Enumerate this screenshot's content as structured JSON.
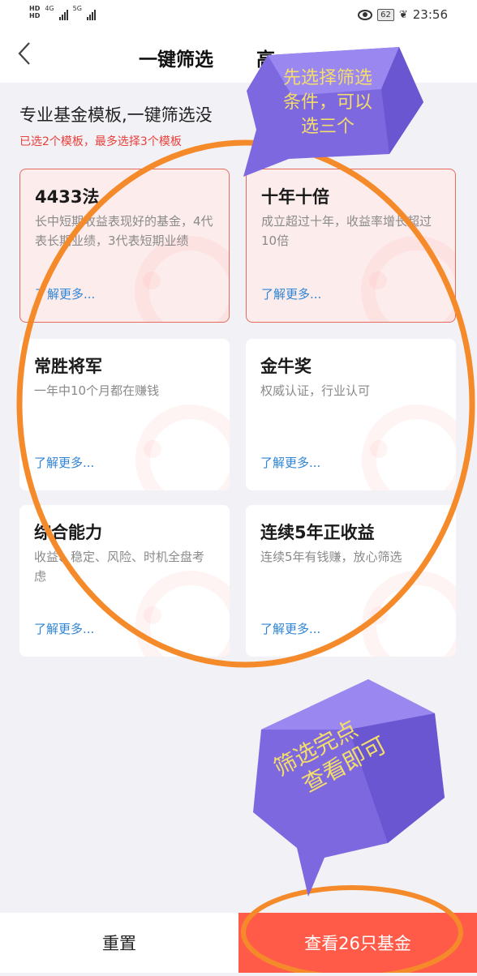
{
  "status_bar": {
    "hd_top": "HD",
    "hd_bottom": "HD",
    "net1": "4G",
    "net2": "5G",
    "battery": "62",
    "time": "23:56"
  },
  "nav": {
    "back_icon": "chevron-left-icon",
    "title": "一键筛选",
    "tab2": "高"
  },
  "headline": "专业基金模板,一键筛选没",
  "selected_note": "已选2个模板，最多选择3个模板",
  "cards": [
    {
      "title": "4433法",
      "desc": "长中短期收益表现好的基金，4代表长期业绩，3代表短期业绩",
      "more": "了解更多...",
      "selected": true
    },
    {
      "title": "十年十倍",
      "desc": "成立超过十年，收益率增长超过10倍",
      "more": "了解更多...",
      "selected": true
    },
    {
      "title": "常胜将军",
      "desc": "一年中10个月都在赚钱",
      "more": "了解更多...",
      "selected": false
    },
    {
      "title": "金牛奖",
      "desc": "权威认证，行业认可",
      "more": "了解更多...",
      "selected": false
    },
    {
      "title": "综合能力",
      "desc": "收益、稳定、风险、时机全盘考虑",
      "more": "了解更多...",
      "selected": false
    },
    {
      "title": "连续5年正收益",
      "desc": "连续5年有钱赚，放心筛选",
      "more": "了解更多...",
      "selected": false
    }
  ],
  "bottom": {
    "reset_label": "重置",
    "view_label": "查看26只基金"
  },
  "annotations": {
    "bubble1": [
      "先选择筛选",
      "条件，可以",
      "选三个"
    ],
    "bubble2": [
      "筛选完点",
      "查看即可"
    ]
  },
  "colors": {
    "accent_red": "#ff5b48",
    "annotation_orange": "#f58a2a",
    "annotation_purple": "#7d68e0",
    "annotation_text": "#f4dd6a",
    "link_blue": "#2f84d6"
  }
}
